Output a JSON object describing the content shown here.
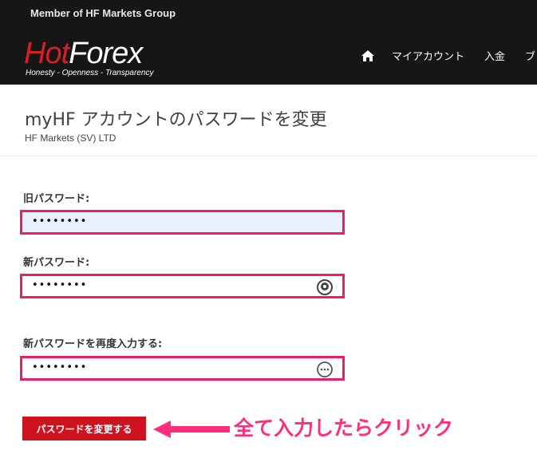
{
  "header": {
    "member_text": "Member of HF Markets Group",
    "logo": {
      "text_red": "Hot",
      "text_white": "Forex",
      "tagline": "Honesty - Openness - Transparency"
    },
    "nav": [
      "マイアカウント",
      "入金",
      "ブ"
    ]
  },
  "page": {
    "title": "myHF アカウントのパスワードを変更",
    "company": "HF Markets (SV) LTD"
  },
  "form": {
    "old_password": {
      "label": "旧パスワード:",
      "value": "••••••••"
    },
    "new_password": {
      "label": "新パスワード:",
      "value": "••••••••"
    },
    "confirm_password": {
      "label": "新パスワードを再度入力する:",
      "value": "••••••••"
    },
    "submit_label": "パスワードを変更する"
  },
  "annotation": {
    "text": "全て入力したらクリック"
  },
  "colors": {
    "header_bg": "#161616",
    "logo_red": "#d71f26",
    "highlight": "#ef1c67",
    "button": "#cf1220",
    "annotation": "#ff2d7d"
  },
  "icons": [
    "home-icon",
    "eye-icon",
    "eye-hidden-icon",
    "arrow-left-icon"
  ]
}
